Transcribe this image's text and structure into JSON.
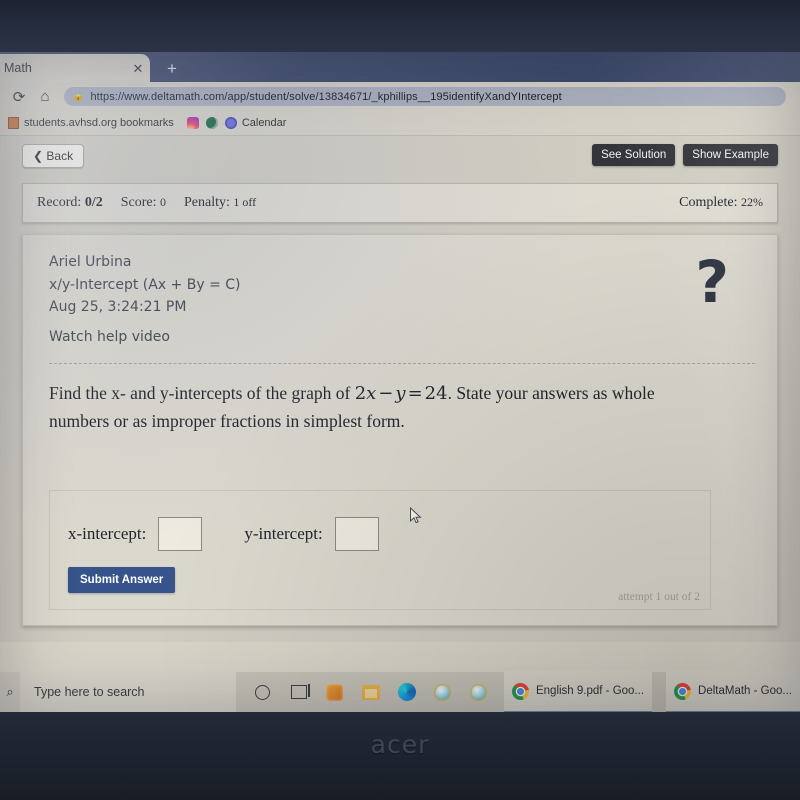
{
  "device": {
    "brand": "acer"
  },
  "browser": {
    "tab": {
      "title": "Math",
      "close_label": "✕"
    },
    "new_tab_label": "+",
    "reload_label": "⟳",
    "home_label": "⌂",
    "lock_icon": "🔒",
    "url": "https://www.deltamath.com/app/student/solve/13834671/_kphillips__195identifyXandYIntercept",
    "bookmarks": [
      {
        "label": "students.avhsd.org bookmarks",
        "icon": "folder-icon"
      },
      {
        "label": "",
        "icon": "instagram-icon"
      },
      {
        "label": "",
        "icon": "globe-icon"
      },
      {
        "label": "Calendar",
        "icon": "calendar-icon"
      }
    ]
  },
  "topbar": {
    "back_label": "Back",
    "back_chevron": "❮",
    "see_solution_label": "See Solution",
    "show_example_label": "Show Example"
  },
  "status": {
    "record_label": "Record:",
    "record_value": "0/2",
    "score_label": "Score:",
    "score_value": "0",
    "penalty_label": "Penalty:",
    "penalty_value": "1 off",
    "complete_label": "Complete:",
    "complete_value": "22%"
  },
  "problem": {
    "student_name": "Ariel Urbina",
    "assignment": "x/y-Intercept (Ax + By = C)",
    "timestamp": "Aug 25, 3:24:21 PM",
    "help_video_label": "Watch help video",
    "help_icon": "?",
    "question_part1": "Find the x- and y-intercepts of the graph of ",
    "equation_lhs_coef": "2",
    "equation_lhs_var": "x",
    "equation_op": "−",
    "equation_rhs_var": "y",
    "equation_eq": "=",
    "equation_value": "24",
    "question_part2": ". State your answers as whole numbers or as improper fractions in simplest form."
  },
  "answer": {
    "x_label": "x-intercept:",
    "x_value": "",
    "y_label": "y-intercept:",
    "y_value": "",
    "submit_label": "Submit Answer",
    "attempt_text": "attempt 1 out of 2",
    "submit_color": "#36538c"
  },
  "taskbar": {
    "search_placeholder": "Type here to search",
    "items": [
      {
        "icon": "office-icon",
        "label": ""
      },
      {
        "icon": "file-explorer-icon",
        "label": ""
      },
      {
        "icon": "edge-icon",
        "label": ""
      },
      {
        "icon": "internet-explorer-icon",
        "label": ""
      },
      {
        "icon": "internet-explorer-icon",
        "label": ""
      }
    ],
    "windows": [
      {
        "icon": "chrome-icon",
        "label": "English 9.pdf - Goo..."
      },
      {
        "icon": "chrome-icon",
        "label": "DeltaMath - Goo..."
      }
    ]
  }
}
